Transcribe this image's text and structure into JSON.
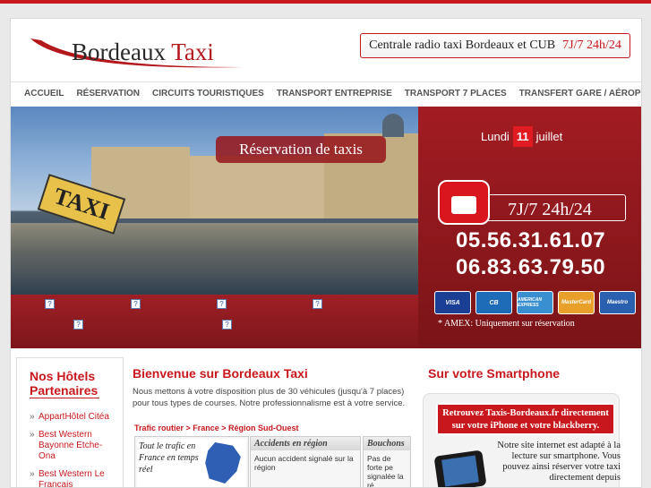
{
  "header": {
    "logo_word1": "Bordeaux",
    "logo_word2": "Taxi",
    "slogan": "Centrale radio taxi Bordeaux et CUB",
    "slogan_hours": "7J/7  24h/24"
  },
  "nav": {
    "items": [
      {
        "label": "Accueil"
      },
      {
        "label": "Réservation"
      },
      {
        "label": "Circuits touristiques"
      },
      {
        "label": "Transport entreprise"
      },
      {
        "label": "Transport 7 places"
      },
      {
        "label": "Transfert gare / aéroport"
      }
    ]
  },
  "hero": {
    "photo_caption": "Réservation de taxis",
    "taxi_sign": "TAXI",
    "broken_image_icon": "?"
  },
  "contact": {
    "weekday": "Lundi",
    "day": "11",
    "month": "juillet",
    "hours": "7J/7  24h/24",
    "phone1": "05.56.31.61.07",
    "phone2": "06.83.63.79.50",
    "cards": [
      "VISA",
      "CB",
      "AMERICAN EXPRESS",
      "MasterCard",
      "Maestro"
    ],
    "amex_note": "* AMEX: Uniquement sur réservation"
  },
  "hotels": {
    "title": "Nos Hôtels Partenaires",
    "items": [
      {
        "label": "AppartHôtel Citéa"
      },
      {
        "label": "Best Western Bayonne Etche-Ona"
      },
      {
        "label": "Best Western Le Français"
      }
    ]
  },
  "main": {
    "title": "Bienvenue sur Bordeaux Taxi",
    "intro": "Nous mettons à votre disposition plus de 30 véhicules (jusqu'à 7 places) pour tous types de courses. Notre professionnalisme est à votre service.",
    "breadcrumb": "Trafic routier > France > Région Sud-Ouest",
    "traffic_map_text": "Tout le trafic en France en temps réel",
    "accidents_title": "Accidents en région",
    "accidents_body": "Aucun accident signalé sur la région",
    "bouchons_title": "Bouchons",
    "bouchons_body": "Pas de forte pe signalée la ré"
  },
  "smartphone": {
    "title": "Sur votre Smartphone",
    "banner": "Retrouvez Taxis-Bordeaux.fr  directement sur votre iPhone et votre blackberry.",
    "text": "Notre site internet est adapté à la lecture sur smartphone. Vous pouvez ainsi réserver votre taxi directement depuis"
  },
  "colors": {
    "brand_red": "#c8181d",
    "dark_red": "#7a1418"
  }
}
